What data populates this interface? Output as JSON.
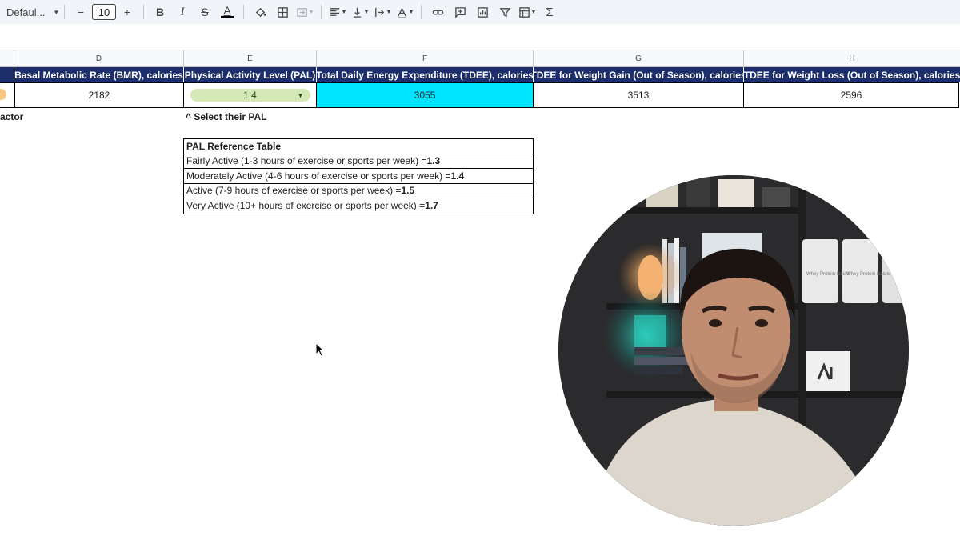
{
  "toolbar": {
    "font_name": "Defaul...",
    "font_size": "10",
    "minus": "−",
    "plus": "+",
    "bold": "B",
    "italic": "I",
    "strike": "S",
    "text_color": "A",
    "sum": "Σ"
  },
  "columns": [
    "D",
    "E",
    "F",
    "G",
    "H"
  ],
  "headers": {
    "bmr": "Basal Metabolic Rate (BMR), calories",
    "pal": "Physical Activity Level (PAL)",
    "tdee": "Total Daily Energy Expenditure (TDEE), calories",
    "gain": "TDEE for Weight Gain (Out of Season), calories",
    "loss": "TDEE for Weight Loss (Out of Season), calories"
  },
  "values": {
    "bmr": "2182",
    "pal": "1.4",
    "tdee": "3055",
    "gain": "3513",
    "loss": "2596"
  },
  "notes": {
    "left_partial": "actor",
    "select_pal": "^ Select their PAL"
  },
  "pal_table": {
    "title": "PAL Reference Table",
    "rows": [
      {
        "label": "Fairly Active (1-3 hours of exercise or sports per week) = ",
        "value": "1.3"
      },
      {
        "label": "Moderately Active (4-6 hours of exercise or sports per week) = ",
        "value": "1.4"
      },
      {
        "label": "Active (7-9 hours of exercise or sports per week) = ",
        "value": "1.5"
      },
      {
        "label": "Very Active (10+ hours of exercise or sports per week) = ",
        "value": "1.7"
      }
    ]
  },
  "webcam": {
    "tub_label_1": "Whey Protein Isolate",
    "tub_label_2": "Whey Protein Isolate"
  },
  "colors": {
    "header_bg": "#1c2e6b",
    "tdee_highlight": "#00e5ff",
    "pal_chip": "#d4e8b8"
  }
}
